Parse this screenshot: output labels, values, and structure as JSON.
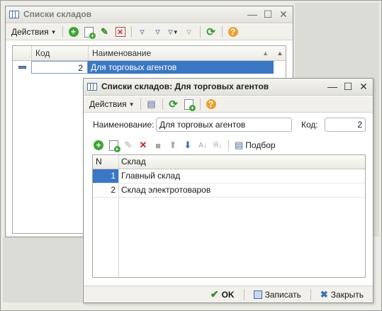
{
  "win1": {
    "title": "Списки складов",
    "menu_label": "Действия",
    "columns": {
      "code": "Код",
      "name": "Наименование"
    },
    "row": {
      "code": "2",
      "name": "Для торговых агентов"
    }
  },
  "win2": {
    "title": "Списки складов: Для торговых агентов",
    "menu_label": "Действия",
    "name_label": "Наименование:",
    "name_value": "Для торговых агентов",
    "code_label": "Код:",
    "code_value": "2",
    "pick_label": "Подбор",
    "columns": {
      "n": "N",
      "warehouse": "Склад"
    },
    "rows": [
      {
        "n": "1",
        "warehouse": "Главный склад"
      },
      {
        "n": "2",
        "warehouse": "Склад электротоваров"
      }
    ],
    "ok_label": "OK",
    "save_label": "Записать",
    "close_label": "Закрыть"
  },
  "colors": {
    "selection": "#3a77c4",
    "accent_green": "#3fa535"
  }
}
